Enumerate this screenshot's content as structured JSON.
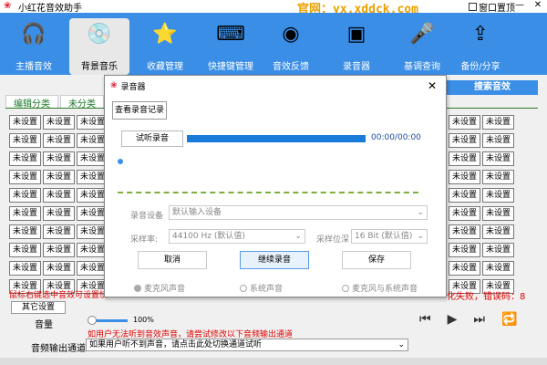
{
  "app": {
    "title": "小红花音效助手",
    "site": "官网：yx.xddck.com",
    "ontop": "窗口置顶",
    "win_min": "—",
    "win_close": "✕"
  },
  "toolbar": [
    {
      "label": "主播音效",
      "icon": "headphones-icon"
    },
    {
      "label": "背景音乐",
      "icon": "music-disc-icon",
      "active": true
    },
    {
      "label": "收藏管理",
      "icon": "star-folder-icon"
    },
    {
      "label": "快捷键管理",
      "icon": "keyboard-icon"
    },
    {
      "label": "音效反馈",
      "icon": "webcam-icon"
    },
    {
      "label": "录音器",
      "icon": "cassette-icon"
    },
    {
      "label": "基调查询",
      "icon": "microphone-icon"
    },
    {
      "label": "备份/分享",
      "icon": "upload-icon"
    }
  ],
  "tabs": [
    "编辑分类",
    "未分类"
  ],
  "search_btn": "搜索音效",
  "cell_label": "未设置",
  "hint_left": "鼠标右键选中音效可设置快",
  "err_right": "化失败，错误码：8",
  "other_btn": "其它设置",
  "volume": {
    "label": "音量",
    "pct": "100%",
    "value": 100
  },
  "warn1": "如用户无法听到音效声音，请尝试修改以下音频输出通道",
  "output": {
    "label": "音频输出通道",
    "value": "如果用户听不到声音，请点击此处切换通道试听"
  },
  "dialog": {
    "title": "录音器",
    "close": "✕",
    "view_records": "查看录音记录",
    "trial": "试听录音",
    "time": "00:00/00:00",
    "progress": 1.0,
    "device_label": "录音设备",
    "device_value": "默认输入设备",
    "rate_label": "采样率:",
    "rate_value": "44100 Hz (默认值)",
    "bits_label": "采样位深",
    "bits_value": "16 Bit (默认值)",
    "cancel": "取消",
    "continue": "继续录音",
    "save": "保存",
    "radios": [
      "麦克风声音",
      "系统声音",
      "麦克风与系统声音"
    ]
  }
}
